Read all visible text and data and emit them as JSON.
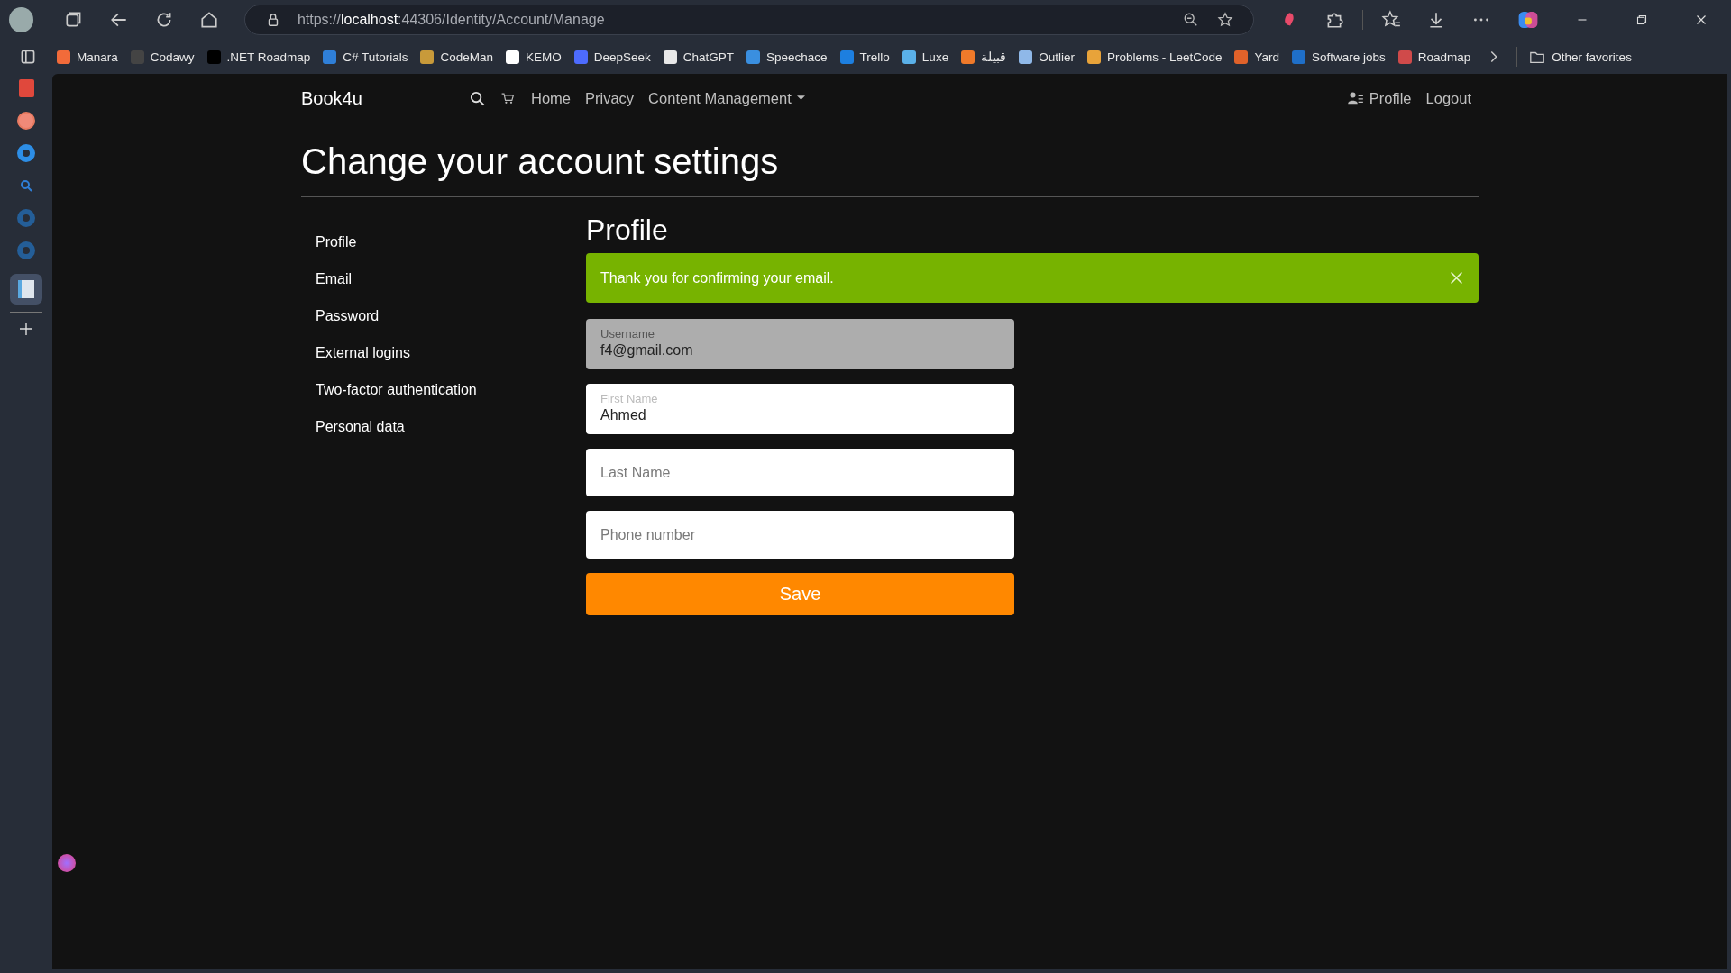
{
  "browser": {
    "url_host": "https://",
    "url_bold": "localhost",
    "url_rest": ":44306/Identity/Account/Manage",
    "bookmarks": [
      {
        "label": "Manara",
        "color": "#f26b3a"
      },
      {
        "label": "Codawy",
        "color": "#444444"
      },
      {
        "label": ".NET Roadmap",
        "color": "#000000"
      },
      {
        "label": "C# Tutorials",
        "color": "#2f7fd8"
      },
      {
        "label": "CodeMan",
        "color": "#c89a3a"
      },
      {
        "label": "KEMO",
        "color": "#ffffff"
      },
      {
        "label": "DeepSeek",
        "color": "#4d6bfe"
      },
      {
        "label": "ChatGPT",
        "color": "#e8e8e8"
      },
      {
        "label": "Speechace",
        "color": "#3a8fe0"
      },
      {
        "label": "Trello",
        "color": "#1d7fe0"
      },
      {
        "label": "Luxe",
        "color": "#5ab0e8"
      },
      {
        "label": "قبيلة",
        "color": "#f07a2a"
      },
      {
        "label": "Outlier",
        "color": "#8fb8e8"
      },
      {
        "label": "Problems - LeetCode",
        "color": "#e8a33a"
      },
      {
        "label": "Yard",
        "color": "#e0622a"
      },
      {
        "label": "Software jobs",
        "color": "#1f6fc8"
      },
      {
        "label": "Roadmap",
        "color": "#d04a4a"
      }
    ],
    "other_favorites": "Other favorites"
  },
  "navbar": {
    "brand": "Book4u",
    "links": [
      "Home",
      "Privacy"
    ],
    "dropdown": "Content Management",
    "profile": "Profile",
    "logout": "Logout"
  },
  "page": {
    "title": "Change your account settings",
    "menu": [
      "Profile",
      "Email",
      "Password",
      "External logins",
      "Two-factor authentication",
      "Personal data"
    ],
    "heading": "Profile",
    "alert": {
      "text": "Thank you for confirming your email.",
      "dismissible": true
    },
    "fields": [
      {
        "label": "Username",
        "value": "f4@gmail.com",
        "disabled": true
      },
      {
        "label": "First Name",
        "value": "Ahmed",
        "disabled": false
      },
      {
        "placeholder": "Last Name",
        "disabled": false
      },
      {
        "placeholder": "Phone number",
        "disabled": false
      }
    ],
    "save_button": "Save"
  }
}
